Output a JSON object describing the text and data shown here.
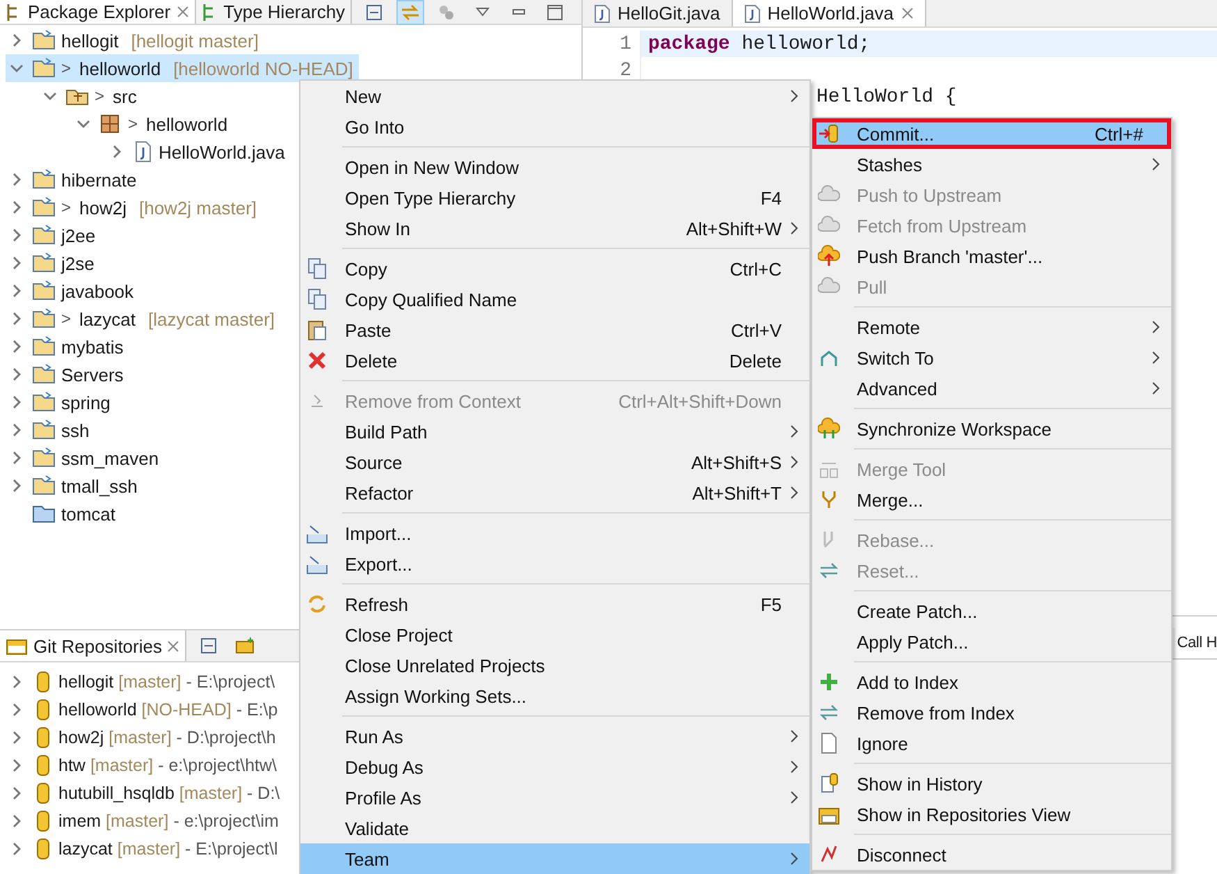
{
  "package_explorer": {
    "tabs": [
      {
        "label": "Package Explorer",
        "selected": true
      },
      {
        "label": "Type Hierarchy",
        "selected": false
      }
    ],
    "tree": [
      {
        "name": "hellogit",
        "decoration": "[hellogit master]",
        "kind": "project",
        "expanded": false,
        "selected": false
      },
      {
        "name": "helloworld",
        "decoration": "[helloworld NO-HEAD]",
        "prefix": ">",
        "kind": "project",
        "expanded": true,
        "selected": true,
        "children": [
          {
            "name": "src",
            "prefix": ">",
            "kind": "source_folder",
            "expanded": true,
            "selected": false,
            "children": [
              {
                "name": "helloworld",
                "prefix": ">",
                "kind": "package",
                "expanded": true,
                "selected": false,
                "children": [
                  {
                    "name": "HelloWorld.java",
                    "kind": "java_file",
                    "expanded": false,
                    "selected": false
                  }
                ]
              }
            ]
          }
        ]
      },
      {
        "name": "hibernate",
        "kind": "project",
        "expanded": false,
        "selected": false
      },
      {
        "name": "how2j",
        "decoration": "[how2j master]",
        "prefix": ">",
        "kind": "project",
        "expanded": false,
        "selected": false
      },
      {
        "name": "j2ee",
        "kind": "project",
        "expanded": false,
        "selected": false
      },
      {
        "name": "j2se",
        "kind": "project",
        "expanded": false,
        "selected": false
      },
      {
        "name": "javabook",
        "kind": "project",
        "expanded": false,
        "selected": false
      },
      {
        "name": "lazycat",
        "decoration": "[lazycat master]",
        "prefix": ">",
        "kind": "project",
        "expanded": false,
        "selected": false
      },
      {
        "name": "mybatis",
        "kind": "project",
        "expanded": false,
        "selected": false
      },
      {
        "name": "Servers",
        "kind": "project",
        "expanded": false,
        "selected": false
      },
      {
        "name": "spring",
        "kind": "project",
        "expanded": false,
        "selected": false
      },
      {
        "name": "ssh",
        "kind": "project",
        "expanded": false,
        "selected": false
      },
      {
        "name": "ssm_maven",
        "kind": "project",
        "expanded": false,
        "selected": false
      },
      {
        "name": "tmall_ssh",
        "kind": "project",
        "expanded": false,
        "selected": false
      },
      {
        "name": "tomcat",
        "kind": "closed_project",
        "selected": false
      }
    ]
  },
  "git_repositories": {
    "title": "Git Repositories",
    "repos": [
      {
        "name": "hellogit",
        "branch": "[master]",
        "path": "- E:\\project\\"
      },
      {
        "name": "helloworld",
        "branch": "[NO-HEAD]",
        "path": "- E:\\p"
      },
      {
        "name": "how2j",
        "branch": "[master]",
        "path": "- D:\\project\\h"
      },
      {
        "name": "htw",
        "branch": "[master]",
        "path": "- e:\\project\\htw\\"
      },
      {
        "name": "hutubill_hsqldb",
        "branch": "[master]",
        "path": "- D:\\"
      },
      {
        "name": "imem",
        "branch": "[master]",
        "path": "- e:\\project\\im"
      },
      {
        "name": "lazycat",
        "branch": "[master]",
        "path": "- E:\\project\\l"
      }
    ]
  },
  "editor": {
    "tabs": [
      {
        "label": "HelloGit.java",
        "selected": false
      },
      {
        "label": "HelloWorld.java",
        "selected": true
      }
    ],
    "lines": [
      {
        "number": "1",
        "keyword": "package",
        "text": " helloworld;",
        "current": true
      },
      {
        "number": "2",
        "current": false
      },
      {
        "text": "HelloWorld {",
        "current": false
      }
    ]
  },
  "bottom_panel": {
    "tabs": [
      "Call H"
    ]
  },
  "context_menu": [
    {
      "kind": "item",
      "label": "New",
      "submenu": true,
      "disabled": false,
      "selected": false
    },
    {
      "kind": "item",
      "label": "Go Into",
      "submenu": false,
      "disabled": false,
      "selected": false
    },
    {
      "kind": "separator"
    },
    {
      "kind": "item",
      "label": "Open in New Window",
      "submenu": false,
      "disabled": false,
      "selected": false
    },
    {
      "kind": "item",
      "label": "Open Type Hierarchy",
      "shortcut": "F4",
      "submenu": false,
      "disabled": false,
      "selected": false
    },
    {
      "kind": "item",
      "label": "Show In",
      "shortcut": "Alt+Shift+W",
      "submenu": true,
      "disabled": false,
      "selected": false
    },
    {
      "kind": "separator"
    },
    {
      "kind": "item",
      "label": "Copy",
      "shortcut": "Ctrl+C",
      "submenu": false,
      "disabled": false,
      "selected": false
    },
    {
      "kind": "item",
      "label": "Copy Qualified Name",
      "submenu": false,
      "disabled": false,
      "selected": false
    },
    {
      "kind": "item",
      "label": "Paste",
      "shortcut": "Ctrl+V",
      "submenu": false,
      "disabled": false,
      "selected": false
    },
    {
      "kind": "item",
      "label": "Delete",
      "shortcut": "Delete",
      "submenu": false,
      "disabled": false,
      "selected": false
    },
    {
      "kind": "separator"
    },
    {
      "kind": "item",
      "label": "Remove from Context",
      "shortcut": "Ctrl+Alt+Shift+Down",
      "submenu": false,
      "disabled": true,
      "selected": false
    },
    {
      "kind": "item",
      "label": "Build Path",
      "submenu": true,
      "disabled": false,
      "selected": false
    },
    {
      "kind": "item",
      "label": "Source",
      "shortcut": "Alt+Shift+S",
      "submenu": true,
      "disabled": false,
      "selected": false
    },
    {
      "kind": "item",
      "label": "Refactor",
      "shortcut": "Alt+Shift+T",
      "submenu": true,
      "disabled": false,
      "selected": false
    },
    {
      "kind": "separator"
    },
    {
      "kind": "item",
      "label": "Import...",
      "submenu": false,
      "disabled": false,
      "selected": false
    },
    {
      "kind": "item",
      "label": "Export...",
      "submenu": false,
      "disabled": false,
      "selected": false
    },
    {
      "kind": "separator"
    },
    {
      "kind": "item",
      "label": "Refresh",
      "shortcut": "F5",
      "submenu": false,
      "disabled": false,
      "selected": false
    },
    {
      "kind": "item",
      "label": "Close Project",
      "submenu": false,
      "disabled": false,
      "selected": false
    },
    {
      "kind": "item",
      "label": "Close Unrelated Projects",
      "submenu": false,
      "disabled": false,
      "selected": false
    },
    {
      "kind": "item",
      "label": "Assign Working Sets...",
      "submenu": false,
      "disabled": false,
      "selected": false
    },
    {
      "kind": "separator"
    },
    {
      "kind": "item",
      "label": "Run As",
      "submenu": true,
      "disabled": false,
      "selected": false
    },
    {
      "kind": "item",
      "label": "Debug As",
      "submenu": true,
      "disabled": false,
      "selected": false
    },
    {
      "kind": "item",
      "label": "Profile As",
      "submenu": true,
      "disabled": false,
      "selected": false
    },
    {
      "kind": "item",
      "label": "Validate",
      "submenu": false,
      "disabled": false,
      "selected": false
    },
    {
      "kind": "item",
      "label": "Team",
      "submenu": true,
      "disabled": false,
      "selected": true
    }
  ],
  "team_menu": [
    {
      "kind": "item",
      "label": "Commit...",
      "shortcut": "Ctrl+#",
      "submenu": false,
      "disabled": false,
      "selected": true,
      "highlighted": true
    },
    {
      "kind": "item",
      "label": "Stashes",
      "submenu": true,
      "disabled": false,
      "selected": false,
      "highlighted": false
    },
    {
      "kind": "item",
      "label": "Push to Upstream",
      "submenu": false,
      "disabled": true,
      "selected": false,
      "highlighted": false
    },
    {
      "kind": "item",
      "label": "Fetch from Upstream",
      "submenu": false,
      "disabled": true,
      "selected": false,
      "highlighted": false
    },
    {
      "kind": "item",
      "label": "Push Branch 'master'...",
      "submenu": false,
      "disabled": false,
      "selected": false,
      "highlighted": false
    },
    {
      "kind": "item",
      "label": "Pull",
      "submenu": false,
      "disabled": true,
      "selected": false,
      "highlighted": false
    },
    {
      "kind": "separator"
    },
    {
      "kind": "item",
      "label": "Remote",
      "submenu": true,
      "disabled": false,
      "selected": false,
      "highlighted": false
    },
    {
      "kind": "item",
      "label": "Switch To",
      "submenu": true,
      "disabled": false,
      "selected": false,
      "highlighted": false
    },
    {
      "kind": "item",
      "label": "Advanced",
      "submenu": true,
      "disabled": false,
      "selected": false,
      "highlighted": false
    },
    {
      "kind": "separator"
    },
    {
      "kind": "item",
      "label": "Synchronize Workspace",
      "submenu": false,
      "disabled": false,
      "selected": false,
      "highlighted": false
    },
    {
      "kind": "separator"
    },
    {
      "kind": "item",
      "label": "Merge Tool",
      "submenu": false,
      "disabled": true,
      "selected": false,
      "highlighted": false
    },
    {
      "kind": "item",
      "label": "Merge...",
      "submenu": false,
      "disabled": false,
      "selected": false,
      "highlighted": false
    },
    {
      "kind": "separator"
    },
    {
      "kind": "item",
      "label": "Rebase...",
      "submenu": false,
      "disabled": true,
      "selected": false,
      "highlighted": false
    },
    {
      "kind": "item",
      "label": "Reset...",
      "submenu": false,
      "disabled": true,
      "selected": false,
      "highlighted": false
    },
    {
      "kind": "separator"
    },
    {
      "kind": "item",
      "label": "Create Patch...",
      "submenu": false,
      "disabled": false,
      "selected": false,
      "highlighted": false
    },
    {
      "kind": "item",
      "label": "Apply Patch...",
      "submenu": false,
      "disabled": false,
      "selected": false,
      "highlighted": false
    },
    {
      "kind": "separator"
    },
    {
      "kind": "item",
      "label": "Add to Index",
      "submenu": false,
      "disabled": false,
      "selected": false,
      "highlighted": false
    },
    {
      "kind": "item",
      "label": "Remove from Index",
      "submenu": false,
      "disabled": false,
      "selected": false,
      "highlighted": false
    },
    {
      "kind": "item",
      "label": "Ignore",
      "submenu": false,
      "disabled": false,
      "selected": false,
      "highlighted": false
    },
    {
      "kind": "separator"
    },
    {
      "kind": "item",
      "label": "Show in History",
      "submenu": false,
      "disabled": false,
      "selected": false,
      "highlighted": false
    },
    {
      "kind": "item",
      "label": "Show in Repositories View",
      "submenu": false,
      "disabled": false,
      "selected": false,
      "highlighted": false
    },
    {
      "kind": "separator"
    },
    {
      "kind": "item",
      "label": "Disconnect",
      "submenu": false,
      "disabled": false,
      "selected": false,
      "highlighted": false
    }
  ]
}
